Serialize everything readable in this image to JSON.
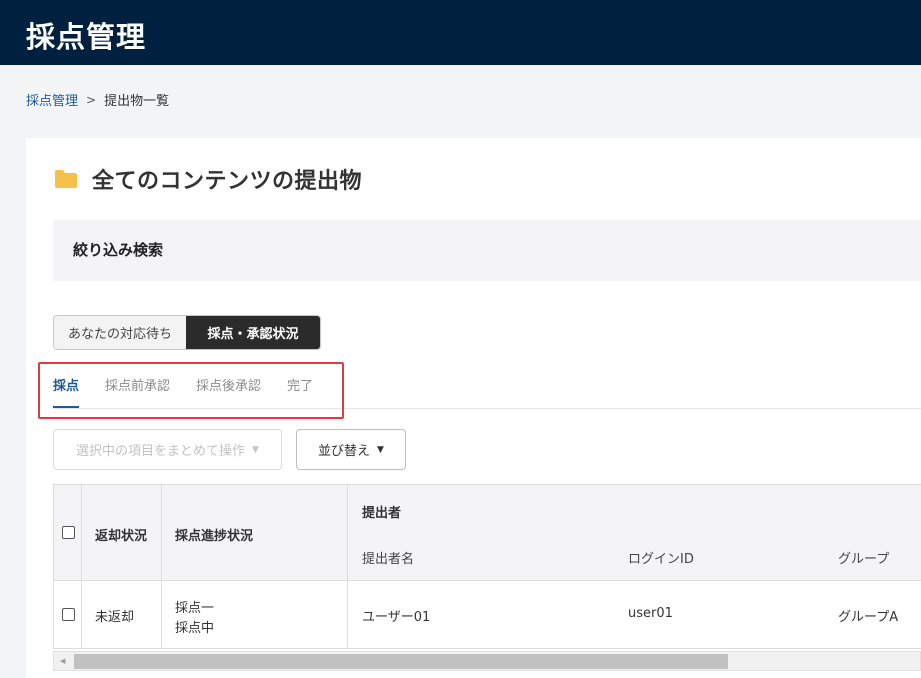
{
  "header": {
    "title": "採点管理"
  },
  "breadcrumb": {
    "parent": "採点管理",
    "separator": ">",
    "current": "提出物一覧"
  },
  "page": {
    "title": "全てのコンテンツの提出物",
    "icon": "folder-icon"
  },
  "filter": {
    "label": "絞り込み検索"
  },
  "segment": {
    "waiting": "あなたの対応待ち",
    "status": "採点・承認状況",
    "selected": "採点・承認状況"
  },
  "tabs": [
    {
      "label": "採点",
      "active": true
    },
    {
      "label": "採点前承認",
      "active": false
    },
    {
      "label": "採点後承認",
      "active": false
    },
    {
      "label": "完了",
      "active": false
    }
  ],
  "toolbar": {
    "bulk_label": "選択中の項目をまとめて操作",
    "sort_label": "並び替え"
  },
  "table": {
    "headers": {
      "return_status": "返却状況",
      "grading_progress": "採点進捗状況",
      "submitter": "提出者",
      "submitter_name": "提出者名",
      "login_id": "ログインID",
      "group": "グループ"
    },
    "rows": [
      {
        "return_status": "未返却",
        "progress_line1": "採点一",
        "progress_line2": "採点中",
        "submitter_name": "ユーザー01",
        "login_id": "user01",
        "group": "グループA"
      }
    ]
  },
  "colors": {
    "header_bg": "#00203f",
    "accent": "#1d5a96",
    "highlight": "#e03c3c"
  }
}
